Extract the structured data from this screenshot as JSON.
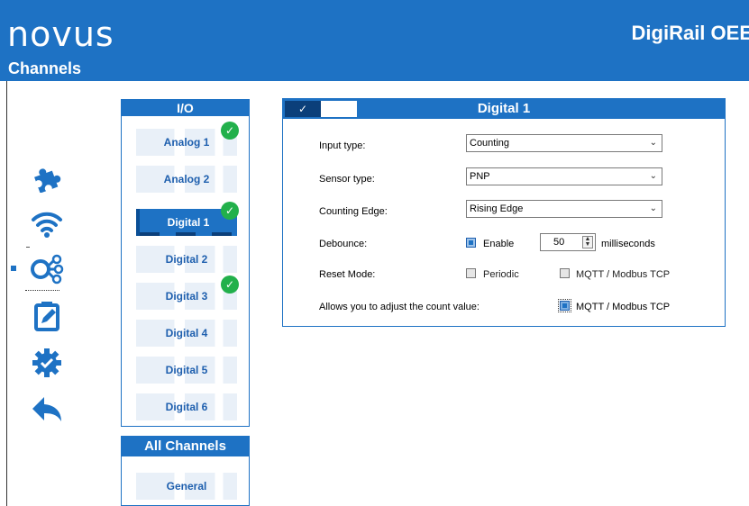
{
  "header": {
    "logo": "novus",
    "subtitle": "Channels",
    "product": "DigiRail OEE"
  },
  "sidebar": {
    "icons": [
      "puzzle-icon",
      "wifi-icon",
      "channels-icon",
      "clipboard-edit-icon",
      "gear-check-icon",
      "back-arrow-icon"
    ]
  },
  "io": {
    "title": "I/O",
    "channels": [
      {
        "label": "Analog 1",
        "checked": true,
        "active": false
      },
      {
        "label": "Analog 2",
        "checked": false,
        "active": false
      },
      {
        "label": "Digital 1",
        "checked": true,
        "active": true
      },
      {
        "label": "Digital 2",
        "checked": false,
        "active": false
      },
      {
        "label": "Digital 3",
        "checked": true,
        "active": false
      },
      {
        "label": "Digital 4",
        "checked": false,
        "active": false
      },
      {
        "label": "Digital 5",
        "checked": false,
        "active": false
      },
      {
        "label": "Digital 6",
        "checked": false,
        "active": false
      }
    ]
  },
  "all_channels": {
    "title": "All Channels",
    "general": "General"
  },
  "digital": {
    "title": "Digital 1",
    "check": "✓",
    "input_type_label": "Input type:",
    "input_type_value": "Counting",
    "sensor_type_label": "Sensor type:",
    "sensor_type_value": "PNP",
    "counting_edge_label": "Counting Edge:",
    "counting_edge_value": "Rising Edge",
    "debounce_label": "Debounce:",
    "debounce_enable": "Enable",
    "debounce_value": "50",
    "debounce_unit": "milliseconds",
    "reset_mode_label": "Reset Mode:",
    "reset_periodic": "Periodic",
    "reset_mqtt": "MQTT / Modbus TCP",
    "adjust_label": "Allows you to adjust the count value:",
    "adjust_mqtt": "MQTT / Modbus TCP"
  },
  "colors": {
    "brand": "#1e72c4",
    "success": "#22b04b"
  }
}
